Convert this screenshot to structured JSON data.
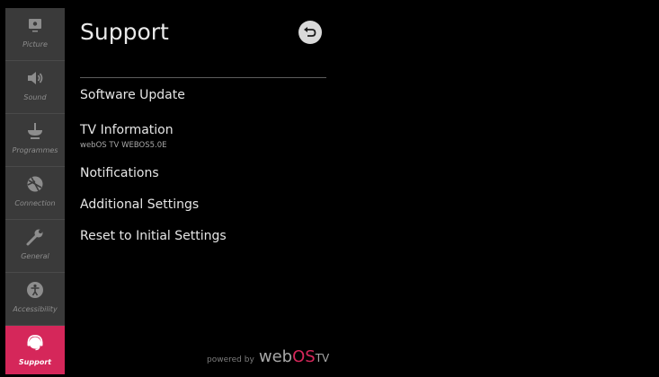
{
  "sidebar": {
    "items": [
      {
        "label": "Picture",
        "icon": "picture-icon",
        "active": false
      },
      {
        "label": "Sound",
        "icon": "speaker-icon",
        "active": false
      },
      {
        "label": "Programmes",
        "icon": "antenna-icon",
        "active": false
      },
      {
        "label": "Connection",
        "icon": "globe-icon",
        "active": false
      },
      {
        "label": "General",
        "icon": "wrench-icon",
        "active": false
      },
      {
        "label": "Accessibility",
        "icon": "accessibility-icon",
        "active": false
      },
      {
        "label": "Support",
        "icon": "headset-icon",
        "active": true
      }
    ]
  },
  "header": {
    "title": "Support",
    "back_icon": "back-arrow-icon"
  },
  "menu": {
    "items": [
      {
        "label": "Software Update"
      },
      {
        "label": "TV Information",
        "sublabel": "webOS TV WEBOS5.0E"
      },
      {
        "label": "Notifications"
      },
      {
        "label": "Additional Settings"
      },
      {
        "label": "Reset to Initial Settings"
      }
    ]
  },
  "footer": {
    "powered_by": "powered by",
    "brand_web": "web",
    "brand_os": "OS",
    "brand_tv": "TV"
  },
  "colors": {
    "accent": "#d5275a",
    "sidebar_bg": "#3a3a3a",
    "background": "#000000"
  }
}
